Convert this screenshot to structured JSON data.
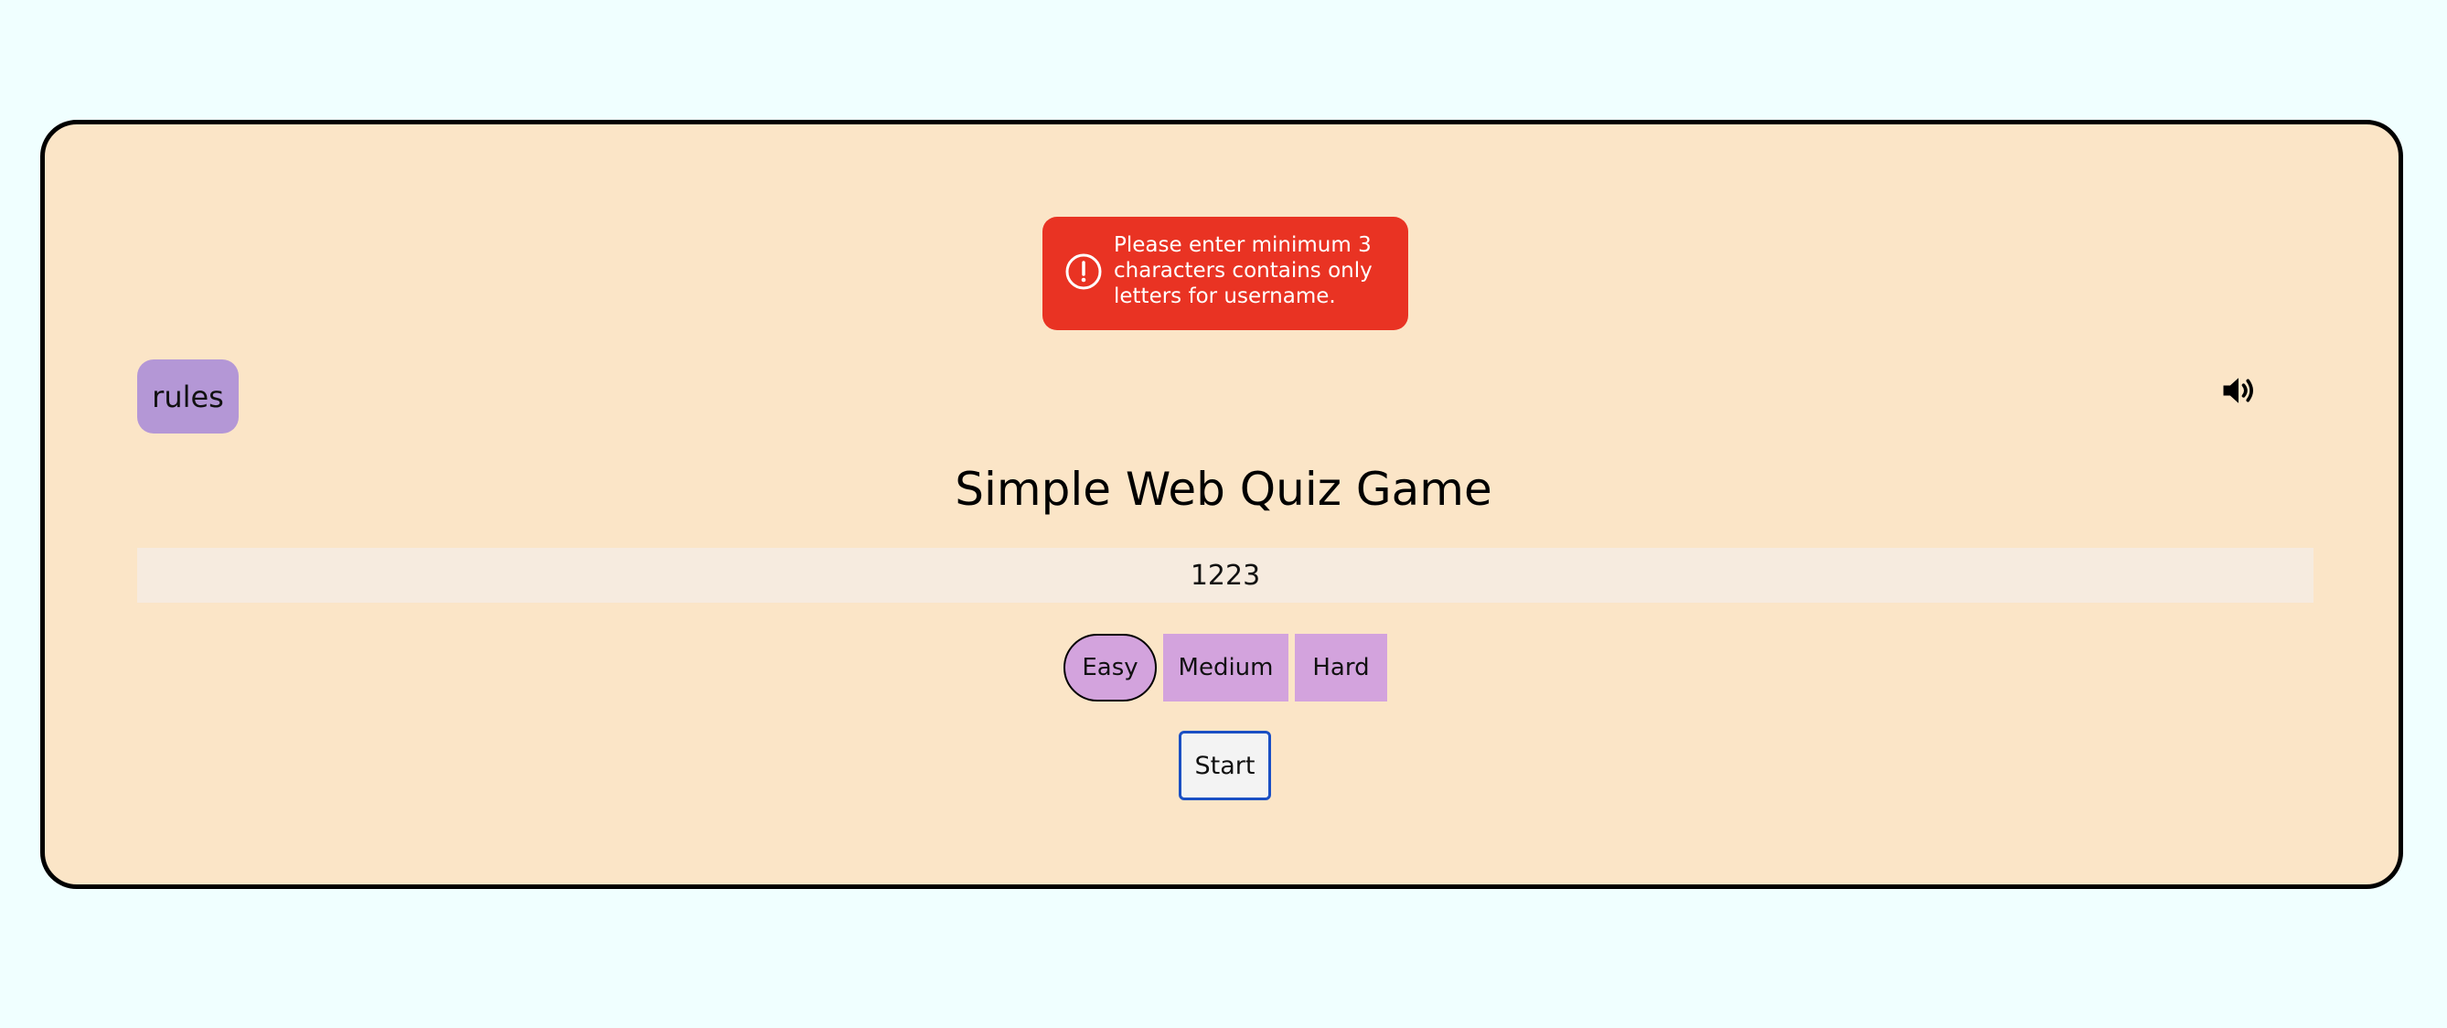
{
  "toast": {
    "message": "Please enter minimum 3 characters contains only letters for username.",
    "icon": "alert-circle-icon",
    "color": "#e93323"
  },
  "header": {
    "rules_label": "rules",
    "sound_icon": "volume-icon"
  },
  "main": {
    "title": "Simple Web Quiz Game",
    "username_value": "1223",
    "difficulty": {
      "options": [
        "Easy",
        "Medium",
        "Hard"
      ],
      "selected": "Easy"
    },
    "start_label": "Start"
  },
  "colors": {
    "page_background": "#f0ffff",
    "card_background": "#fbe5c7",
    "rules_button": "#b497d6",
    "difficulty_button": "#d3a3dd",
    "start_border": "#1a4fc4"
  }
}
